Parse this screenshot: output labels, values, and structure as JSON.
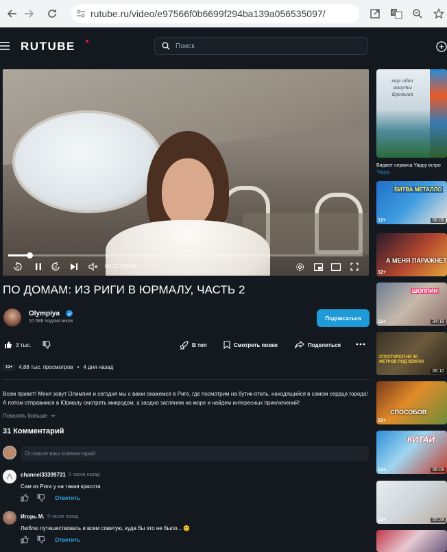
{
  "browser": {
    "url": "rutube.ru/video/e97566f0b6699f294ba139a056535097/"
  },
  "header": {
    "logo": "RUTUBE",
    "search_placeholder": "Поиск"
  },
  "player": {
    "time": "00:22 / 06:06",
    "progress": 0.06,
    "skip_back_label": "10",
    "skip_fwd_label": "10"
  },
  "video": {
    "title": "ПО ДОМАМ: ИЗ РИГИ В ЮРМАЛУ, ЧАСТЬ 2",
    "channel": "Olympiya",
    "subscribers": "10 588 подписчиков",
    "subscribe_label": "Подписаться",
    "likes": "3 тыс.",
    "actions": {
      "top": "В топ",
      "watch_later": "Смотреть позже",
      "share": "Поделиться"
    },
    "age_rating": "12+",
    "views": "4,88 тыс. просмотров",
    "dot": "•",
    "posted": "4 дня назад",
    "description": "Всем привет! Меня зовут Олимпия и сегодня мы с вами окажемся в Риге, где посмотрим на бутик-отель, находящийся в самом сердце города! А потом отправимся в Юрмалу смотреть микродом, а заодно заглянем на море и найдем интересных приключений!",
    "show_more": "Показать больше"
  },
  "comments": {
    "header": "31 Комментарий",
    "input_placeholder": "Оставьте ваш комментарий",
    "reply_label": "Ответить",
    "items": [
      {
        "user": "channel33399731",
        "time": "5 часов назад",
        "text": "Сам из Риги  у на  такая красота"
      },
      {
        "user": "Игорь М.",
        "time": "9 часов назад",
        "text": "Люблю путешествовать и всем советую, куда бы это не было... 😊"
      }
    ]
  },
  "sidebar": {
    "widget_title": "Виджет сервиса Yappy встро",
    "widget_sub": "Yappy",
    "thumb_texts": [
      "еще один минуты Бразилия",
      "БИТВА МЕТАЛЛО",
      "А МЕНЯ ПАРАЖНЕТ",
      "ШОППИН",
      "СПУСТИЛСЯ НА 40 МЕТРОВ ПОД ЗЕМЛЮ",
      "СПОСОБОВ",
      "КИТАЙ",
      "",
      ""
    ],
    "thumbs": [
      {
        "age": "12+",
        "duration": "06:06"
      },
      {
        "age": "12+",
        "duration": ""
      },
      {
        "age": "12+",
        "duration": "34:18"
      },
      {
        "age": "12+",
        "duration": "06:10"
      },
      {
        "age": "12+",
        "duration": ""
      },
      {
        "age": "12+",
        "duration": "06:09"
      },
      {
        "age": "12+",
        "duration": "05:28"
      }
    ]
  }
}
